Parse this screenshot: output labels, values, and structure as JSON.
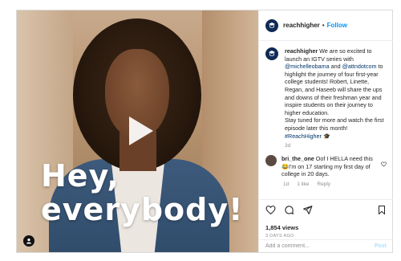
{
  "video": {
    "caption_line1": "Hey,",
    "caption_line2": "everybody!"
  },
  "header": {
    "username": "reachhigher",
    "separator": "•",
    "follow_label": "Follow"
  },
  "post": {
    "username": "reachhigher",
    "text_1": " We are so excited to launch an IGTV series with ",
    "mention_1": "@michelleobama",
    "text_2": " and ",
    "mention_2": "@attndotcom",
    "text_3": " to highlight the journey of four first-year college students! Robert, Linette, Regan, and Haseeb will share the ups and downs of their freshman year and inspire students on their journey to higher education.",
    "text_4": "Stay tuned for more and watch the first episode later this month!",
    "hashtag": "#ReachHigher",
    "emoji": "🎓",
    "time": "3d"
  },
  "comment": {
    "username": "bri_the_one",
    "text": " Oof I HELLA need this 😂I'm on 17 starting my first day of college in 20 days.",
    "time": "1d",
    "likes": "1 like",
    "reply_label": "Reply"
  },
  "stats": {
    "views": "1,854 views",
    "ago": "3 DAYS AGO"
  },
  "add_comment": {
    "placeholder": "Add a comment...",
    "post_label": "Post"
  },
  "colors": {
    "accent": "#0095f6",
    "link": "#00376b",
    "muted": "#8e8e8e"
  }
}
